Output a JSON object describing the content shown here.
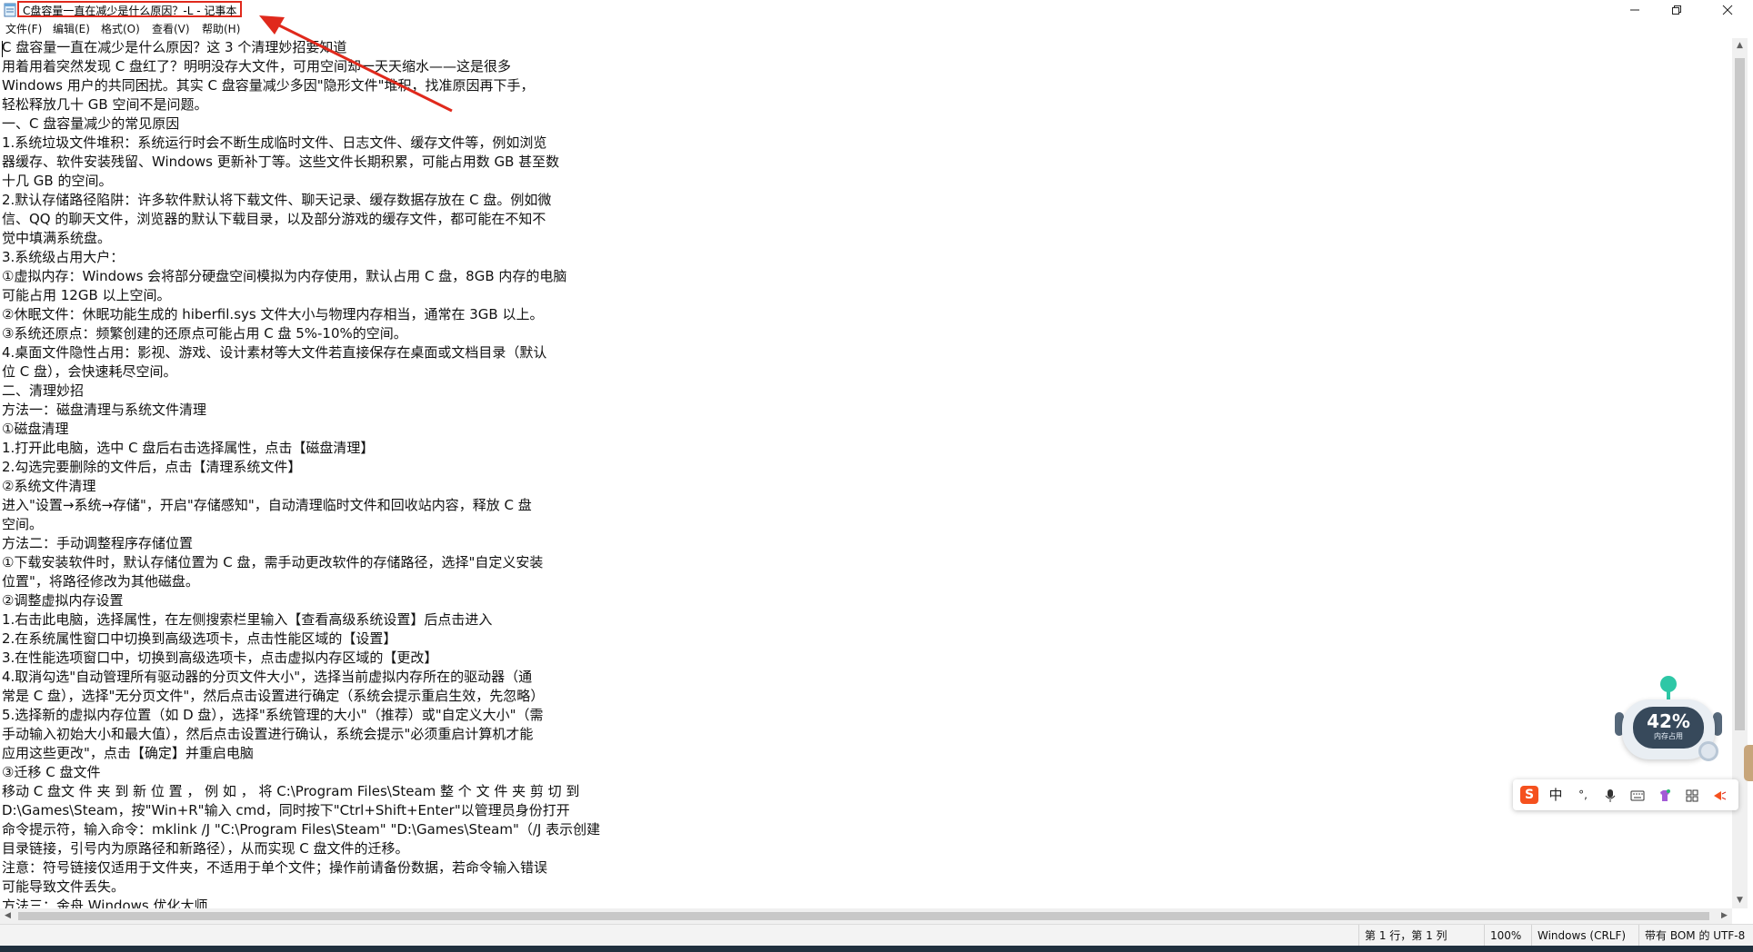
{
  "window": {
    "title": "C盘容量一直在减少是什么原因？-L - 记事本",
    "minimize_icon": "minimize-icon",
    "maximize_icon": "maximize-icon",
    "close_icon": "close-icon",
    "annotation_color": "#e0291c"
  },
  "menu": {
    "items": [
      "文件(F)",
      "编辑(E)",
      "格式(O)",
      "查看(V)",
      "帮助(H)"
    ]
  },
  "document": {
    "lines": [
      "C 盘容量一直在减少是什么原因？这 3 个清理妙招要知道",
      "用着用着突然发现 C 盘红了？明明没存大文件，可用空间却一天天缩水——这是很多",
      "Windows 用户的共同困扰。其实 C 盘容量减少多因\"隐形文件\"堆积，找准原因再下手，",
      "轻松释放几十 GB 空间不是问题。",
      "一、C 盘容量减少的常见原因",
      "1.系统垃圾文件堆积：系统运行时会不断生成临时文件、日志文件、缓存文件等，例如浏览",
      "器缓存、软件安装残留、Windows 更新补丁等。这些文件长期积累，可能占用数 GB 甚至数",
      "十几 GB 的空间。",
      "2.默认存储路径陷阱：许多软件默认将下载文件、聊天记录、缓存数据存放在 C 盘。例如微",
      "信、QQ 的聊天文件，浏览器的默认下载目录，以及部分游戏的缓存文件，都可能在不知不",
      "觉中填满系统盘。",
      "3.系统级占用大户：",
      "①虚拟内存：Windows 会将部分硬盘空间模拟为内存使用，默认占用 C 盘，8GB 内存的电脑",
      "可能占用 12GB 以上空间。",
      "②休眠文件：休眠功能生成的 hiberfil.sys 文件大小与物理内存相当，通常在 3GB 以上。",
      "③系统还原点：频繁创建的还原点可能占用 C 盘 5%-10%的空间。",
      "4.桌面文件隐性占用：影视、游戏、设计素材等大文件若直接保存在桌面或文档目录（默认",
      "位 C 盘），会快速耗尽空间。",
      "二、清理妙招",
      "方法一：磁盘清理与系统文件清理",
      "①磁盘清理",
      "1.打开此电脑，选中 C 盘后右击选择属性，点击【磁盘清理】",
      "2.勾选完要删除的文件后，点击【清理系统文件】",
      "②系统文件清理",
      "进入\"设置→系统→存储\"，开启\"存储感知\"，自动清理临时文件和回收站内容，释放 C 盘",
      "空间。",
      "方法二：手动调整程序存储位置",
      "①下载安装软件时，默认存储位置为 C 盘，需手动更改软件的存储路径，选择\"自定义安装",
      "位置\"，将路径修改为其他磁盘。",
      "②调整虚拟内存设置",
      "1.右击此电脑，选择属性，在左侧搜索栏里输入【查看高级系统设置】后点击进入",
      "2.在系统属性窗口中切换到高级选项卡，点击性能区域的【设置】",
      "3.在性能选项窗口中，切换到高级选项卡，点击虚拟内存区域的【更改】",
      "4.取消勾选\"自动管理所有驱动器的分页文件大小\"，选择当前虚拟内存所在的驱动器（通",
      "常是 C 盘），选择\"无分页文件\"，然后点击设置进行确定（系统会提示重启生效，先忽略）",
      "5.选择新的虚拟内存位置（如 D 盘），选择\"系统管理的大小\"（推荐）或\"自定义大小\"（需",
      "手动输入初始大小和最大值），然后点击设置进行确认，系统会提示\"必须重启计算机才能",
      "应用这些更改\"，点击【确定】并重启电脑",
      "③迁移 C 盘文件",
      "移动 C 盘文 件 夹 到 新 位 置 ， 例 如 ， 将 C:\\Program Files\\Steam 整 个 文 件 夹 剪 切 到",
      "D:\\Games\\Steam，按\"Win+R\"输入 cmd，同时按下\"Ctrl+Shift+Enter\"以管理员身份打开",
      "命令提示符，输入命令：mklink /J \"C:\\Program Files\\Steam\" \"D:\\Games\\Steam\"（/J 表示创建",
      "目录链接，引号内为原路径和新路径），从而实现 C 盘文件的迁移。",
      "注意：符号链接仅适用于文件夹，不适用于单个文件；操作前请备份数据，若命令输入错误",
      "可能导致文件丢失。",
      "方法三：金舟 Windows 优化大师"
    ]
  },
  "status": {
    "position": "第 1 行，第 1 列",
    "zoom": "100%",
    "line_ending": "Windows (CRLF)",
    "encoding": "带有 BOM 的 UTF-8"
  },
  "widget": {
    "percent": "42%",
    "label": "内存占用",
    "icon": "robot-monitor-icon",
    "pin_color": "#2ec7a6"
  },
  "ime": {
    "logo": "S",
    "mode": "中",
    "punct": "°,",
    "icons": [
      "sogou-logo-icon",
      "mic-icon",
      "keyboard-icon",
      "skin-icon",
      "grid-icon",
      "more-icon"
    ]
  }
}
